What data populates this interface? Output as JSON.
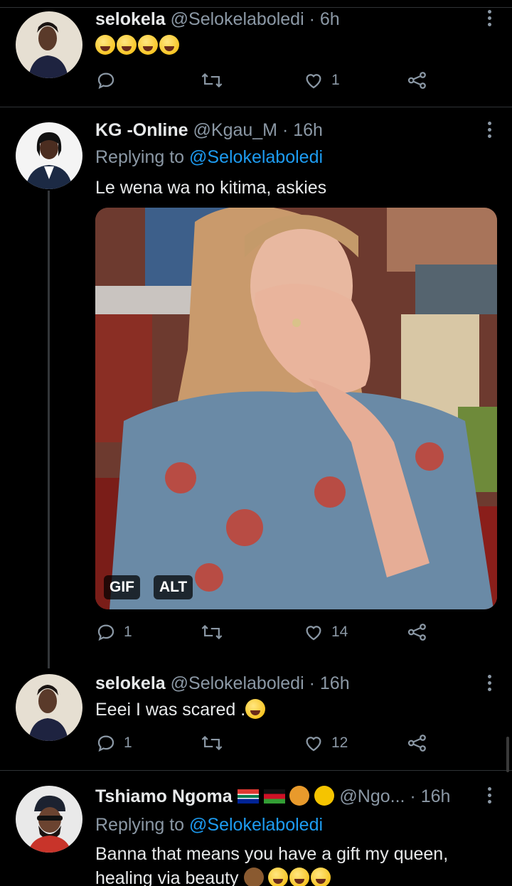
{
  "tweets": [
    {
      "name": "selokela",
      "handle": "@Selokelaboledi",
      "time": "· 6h",
      "text": "",
      "emojis": [
        "joy-emoji",
        "joy-emoji",
        "joy-emoji",
        "joy-emoji"
      ],
      "likes": "1",
      "replies": "",
      "retweets": ""
    },
    {
      "name": "KG -Online",
      "handle": "@Kgau_M",
      "time": "· 16h",
      "replying_prefix": "Replying to",
      "replying_to": "@Selokelaboledi",
      "text": "Le wena wa no kitima, askies",
      "media": {
        "gif_label": "GIF",
        "alt_label": "ALT"
      },
      "replies": "1",
      "retweets": "",
      "likes": "14"
    },
    {
      "name": "selokela",
      "handle": "@Selokelaboledi",
      "time": "· 16h",
      "text": "Eeei I was scared .",
      "replies": "1",
      "retweets": "",
      "likes": "12"
    },
    {
      "name": "Tshiamo Ngoma",
      "handle": "@Ngo...",
      "time": "· 16h",
      "replying_prefix": "Replying to",
      "replying_to": "@Selokelaboledi",
      "text_line1": "Banna that means you have a gift my queen,",
      "text_line2": "healing via beauty"
    }
  ],
  "colors": {
    "background": "#000000",
    "text": "#e7e9ea",
    "muted": "#8b98a5",
    "link": "#1d9bf0",
    "divider": "#2f3336"
  }
}
